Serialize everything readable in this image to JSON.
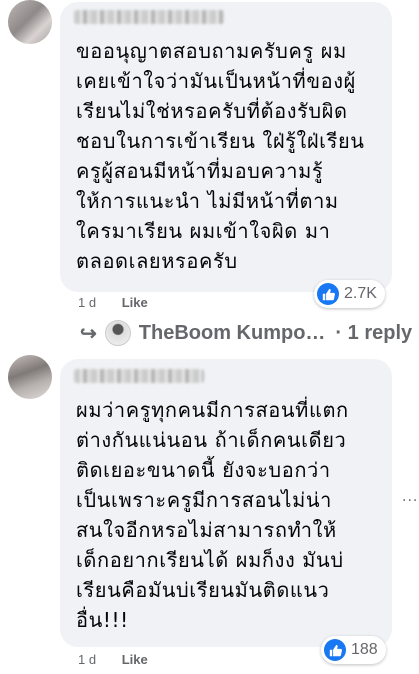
{
  "comments": [
    {
      "text_lines": [
        "ขออนุญาตสอบถามครับครู ผม",
        "เคยเข้าใจว่ามันเป็นหน้าที่ของผู้",
        "เรียนไม่ใช่หรอครับที่ต้องรับผิด",
        "ชอบในการเข้าเรียน ใฝ่รู้ใฝ่เรียน",
        "ครูผู้สอนมีหน้าที่มอบความรู้",
        "ให้การแนะนำ ไม่มีหน้าที่ตาม",
        "ใครมาเรียน ผมเข้าใจผิด มา",
        "ตลอดเลยหรอครับ"
      ],
      "time": "1 d",
      "like_label": "Like",
      "reaction_count": "2.7K",
      "reply_summary": {
        "arrow": "↪",
        "name": "TheBoom Kumpo…",
        "count": "· 1 reply"
      }
    },
    {
      "text_lines": [
        "ผมว่าครูทุกคนมีการสอนที่แตก",
        "ต่างกันแน่นอน ถ้าเด็กคนเดียว",
        "ติดเยอะขนาดนี้ ยังจะบอกว่า",
        "เป็นเพราะครูมีการสอนไม่น่า",
        "สนใจอีกหรอไม่สามารถทำให้",
        "เด็กอยากเรียนได้ ผมก็งง มันบ่",
        "เรียนคือมันบ่เรียนมันติดแนว",
        "อื่น!!!"
      ],
      "time": "1 d",
      "like_label": "Like",
      "reaction_count": "188"
    }
  ],
  "more_options": "···",
  "colors": {
    "bubble": "#f0f2f5",
    "like_blue": "#1877f2",
    "meta_gray": "#65676b"
  }
}
